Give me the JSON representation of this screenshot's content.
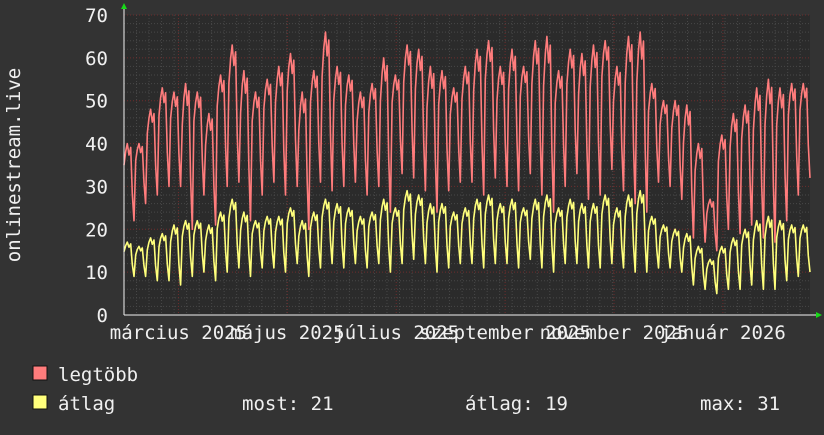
{
  "chart_data": {
    "type": "line",
    "ylabel": "onlinestream.live",
    "ylim": [
      0,
      70
    ],
    "y_ticks": [
      0,
      10,
      20,
      30,
      40,
      50,
      60,
      70
    ],
    "x_ticks": [
      {
        "label": "március 2025",
        "month": 2.0
      },
      {
        "label": "május 2025",
        "month": 4.0
      },
      {
        "label": "július 2025",
        "month": 6.0
      },
      {
        "label": "szeptember 2025",
        "month": 8.0
      },
      {
        "label": "november 2025",
        "month": 10.0
      },
      {
        "label": "január 2026",
        "month": 12.0
      }
    ],
    "x_range_months": [
      1.0,
      13.6
    ],
    "grid": true,
    "colors": {
      "background": "#333333",
      "plot_area": "#2b2b2b",
      "grid_minor": "#484848",
      "grid_major": "#6e2c2c",
      "text": "#f0f0f0",
      "axis_arrow": "#18d818",
      "max_series": "#ff7c7c",
      "avg_series": "#ffff7c"
    },
    "series": [
      {
        "name": "legtöbb",
        "color": "#ff7c7c",
        "weekly_peaks": [
          40,
          40,
          48,
          53,
          52,
          54,
          52,
          47,
          56,
          63,
          57,
          52,
          55,
          58,
          61,
          52,
          57,
          66,
          58,
          56,
          52,
          54,
          60,
          56,
          63,
          62,
          58,
          57,
          53,
          58,
          62,
          64,
          58,
          62,
          58,
          64,
          65,
          57,
          62,
          61,
          63,
          64,
          58,
          65,
          66,
          54,
          50,
          50,
          49,
          40,
          27,
          42,
          47,
          49,
          53,
          55,
          53,
          54,
          54
        ],
        "weekly_lows": [
          22,
          26,
          28,
          30,
          30,
          20,
          28,
          21,
          30,
          31,
          22,
          28,
          31,
          28,
          30,
          20,
          31,
          29,
          30,
          31,
          28,
          30,
          24,
          33,
          32,
          29,
          24,
          29,
          31,
          31,
          28,
          32,
          30,
          29,
          33,
          28,
          24,
          30,
          33,
          27,
          28,
          34,
          29,
          26,
          24,
          31,
          30,
          27,
          18,
          17,
          15,
          20,
          19,
          21,
          18,
          17,
          22,
          28,
          32
        ]
      },
      {
        "name": "átlag",
        "color": "#ffff7c",
        "weekly_peaks": [
          17,
          16,
          18,
          19,
          21,
          22,
          22,
          21,
          24,
          27,
          24,
          22,
          23,
          23,
          25,
          22,
          24,
          27,
          26,
          25,
          23,
          24,
          27,
          25,
          29,
          28,
          26,
          26,
          24,
          25,
          27,
          28,
          26,
          27,
          25,
          27,
          28,
          25,
          27,
          26,
          26,
          28,
          25,
          28,
          29,
          23,
          21,
          20,
          19,
          16,
          13,
          16,
          18,
          20,
          22,
          23,
          22,
          21,
          21
        ],
        "weekly_lows": [
          9,
          9,
          8,
          8,
          7,
          9,
          10,
          8,
          10,
          11,
          9,
          11,
          11,
          10,
          12,
          9,
          11,
          12,
          11,
          12,
          11,
          12,
          10,
          12,
          13,
          12,
          10,
          11,
          12,
          12,
          11,
          12,
          12,
          11,
          13,
          11,
          10,
          12,
          12,
          11,
          11,
          12,
          11,
          10,
          10,
          11,
          11,
          10,
          7,
          6,
          5,
          6,
          6,
          7,
          6,
          6,
          8,
          9,
          10
        ]
      }
    ]
  },
  "legend": {
    "items": [
      {
        "label": "legtöbb",
        "color": "#ff7c7c"
      },
      {
        "label": "átlag",
        "color": "#ffff7c"
      }
    ],
    "stats": {
      "most": "most: 21",
      "atlag": "átlag: 19",
      "max": "max: 31"
    }
  }
}
